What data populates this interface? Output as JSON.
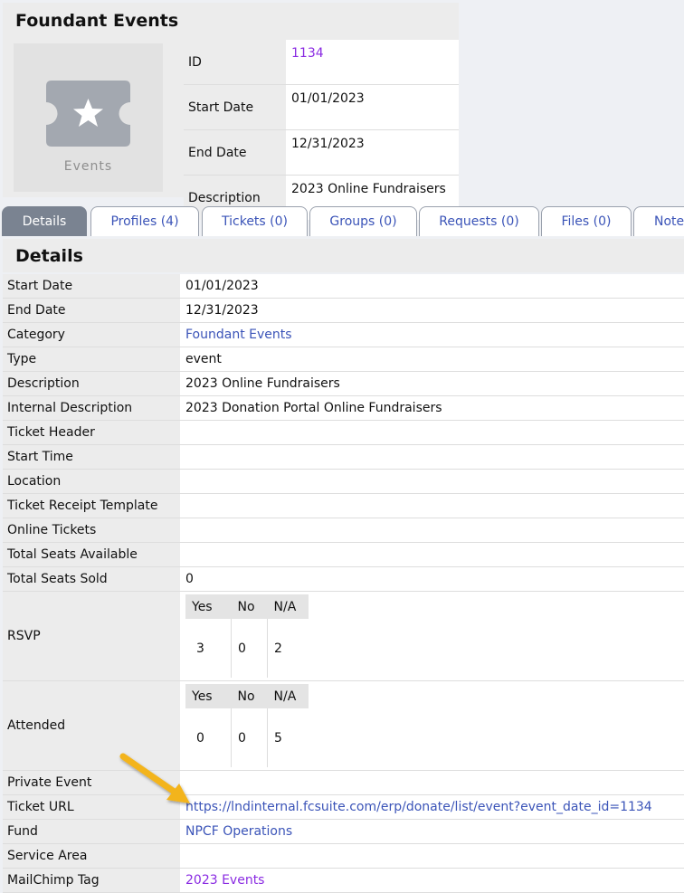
{
  "header": {
    "title": "Foundant Events",
    "thumbnail_label": "Events",
    "icon": "ticket-star-icon",
    "summary": [
      {
        "label": "ID",
        "value": "1134",
        "link": true
      },
      {
        "label": "Start Date",
        "value": "01/01/2023"
      },
      {
        "label": "End Date",
        "value": "12/31/2023"
      },
      {
        "label": "Description",
        "value": "2023 Online Fundraisers"
      }
    ]
  },
  "tabs": [
    {
      "label": "Details",
      "active": true
    },
    {
      "label": "Profiles (4)"
    },
    {
      "label": "Tickets (0)"
    },
    {
      "label": "Groups (0)"
    },
    {
      "label": "Requests (0)"
    },
    {
      "label": "Files (0)"
    },
    {
      "label": "Note"
    }
  ],
  "details": {
    "heading": "Details",
    "rows": [
      {
        "label": "Start Date",
        "value": "01/01/2023"
      },
      {
        "label": "End Date",
        "value": "12/31/2023"
      },
      {
        "label": "Category",
        "value": "Foundant Events",
        "link": "blue"
      },
      {
        "label": "Type",
        "value": "event"
      },
      {
        "label": "Description",
        "value": "2023 Online Fundraisers"
      },
      {
        "label": "Internal Description",
        "value": "2023 Donation Portal Online Fundraisers"
      },
      {
        "label": "Ticket Header",
        "value": ""
      },
      {
        "label": "Start Time",
        "value": ""
      },
      {
        "label": "Location",
        "value": ""
      },
      {
        "label": "Ticket Receipt Template",
        "value": ""
      },
      {
        "label": "Online Tickets",
        "value": ""
      },
      {
        "label": "Total Seats Available",
        "value": ""
      },
      {
        "label": "Total Seats Sold",
        "value": "0"
      }
    ],
    "rsvp": {
      "label": "RSVP",
      "headers": [
        "Yes",
        "No",
        "N/A"
      ],
      "values": [
        "3",
        "0",
        "2"
      ]
    },
    "attended": {
      "label": "Attended",
      "headers": [
        "Yes",
        "No",
        "N/A"
      ],
      "values": [
        "0",
        "0",
        "5"
      ]
    },
    "rows2": [
      {
        "label": "Private Event",
        "value": ""
      },
      {
        "label": "Ticket URL",
        "value": "https://lndinternal.fcsuite.com/erp/donate/list/event?event_date_id=1134",
        "link": "blue"
      },
      {
        "label": "Fund",
        "value": "NPCF Operations",
        "link": "blue"
      },
      {
        "label": "Service Area",
        "value": ""
      },
      {
        "label": "MailChimp Tag",
        "value": "2023 Events",
        "link": "purple"
      }
    ]
  },
  "colors": {
    "tab_active": "#7a8391",
    "link_blue": "#3b54b8",
    "link_purple": "#8a2be2",
    "arrow": "#f3b41b"
  }
}
